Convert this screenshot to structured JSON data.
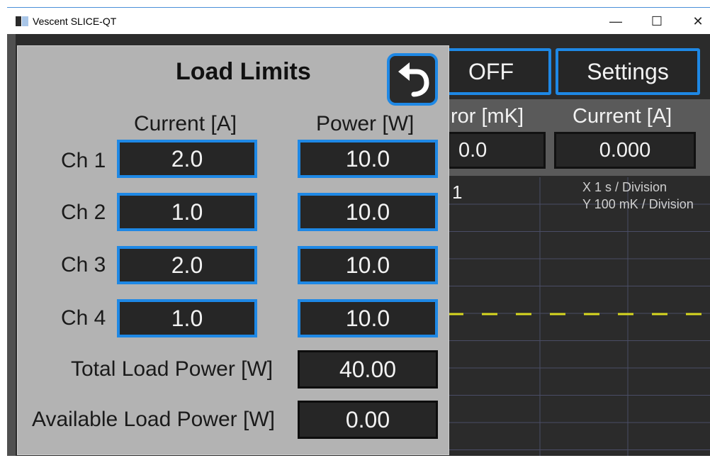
{
  "window": {
    "title": "Vescent SLICE-QT",
    "minimize": "—",
    "maximize": "☐",
    "close": "✕"
  },
  "background": {
    "output_button": "OFF",
    "settings_button": "Settings",
    "error_header": "ror [mK]",
    "current_header": "Current [A]",
    "error_value": "0.0",
    "current_value": "0.000",
    "scope": {
      "channel": "1",
      "x_scale": "X  1 s / Division",
      "y_scale": "Y  100 mK / Division",
      "trace_color": "#d8d820",
      "grid_color": "#4a4d66"
    }
  },
  "dialog": {
    "title": "Load Limits",
    "back_icon": "undo-arrow-icon",
    "current_header": "Current [A]",
    "power_header": "Power [W]",
    "channels": [
      {
        "label": "Ch 1",
        "current": "2.0",
        "power": "10.0"
      },
      {
        "label": "Ch 2",
        "current": "1.0",
        "power": "10.0"
      },
      {
        "label": "Ch 3",
        "current": "2.0",
        "power": "10.0"
      },
      {
        "label": "Ch 4",
        "current": "1.0",
        "power": "10.0"
      }
    ],
    "total_label": "Total Load Power [W]",
    "total_value": "40.00",
    "available_label": "Available Load Power [W]",
    "available_value": "0.00"
  },
  "colors": {
    "accent": "#1e88e5",
    "dialog_bg": "#b3b3b3",
    "field_bg": "#262626"
  }
}
